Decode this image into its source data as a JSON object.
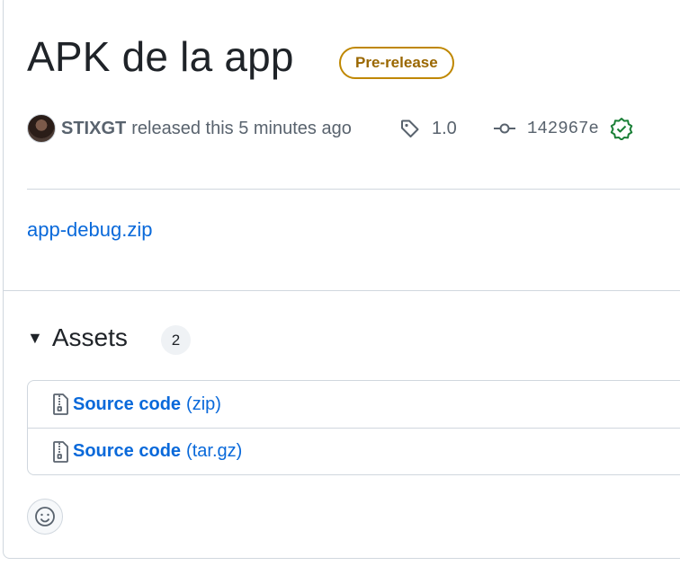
{
  "release": {
    "title": "APK de la app",
    "badge": "Pre-release",
    "author": "STIXGT",
    "released_text": "released this 5 minutes ago",
    "tag": "1.0",
    "commit": "142967e"
  },
  "body": {
    "link_text": "app-debug.zip"
  },
  "assets": {
    "heading": "Assets",
    "count": "2",
    "items": [
      {
        "label": "Source code",
        "ext": "(zip)"
      },
      {
        "label": "Source code",
        "ext": "(tar.gz)"
      }
    ]
  },
  "colors": {
    "link": "#0969da",
    "prerelease": "#bf8700",
    "verified": "#1a7f37"
  }
}
